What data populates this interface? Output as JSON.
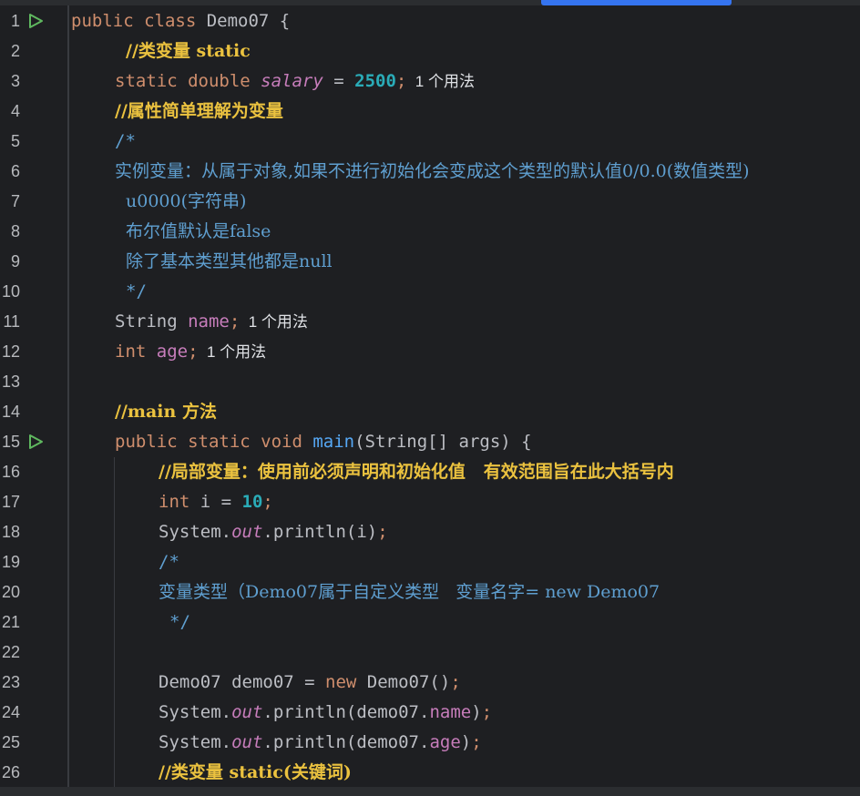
{
  "editor": {
    "lines": [
      {
        "n": "1",
        "run": true,
        "indent": 78,
        "tokens": [
          {
            "t": "public class ",
            "c": "kw"
          },
          {
            "t": "Demo07 {",
            "c": "plain"
          }
        ]
      },
      {
        "n": "2",
        "indent": 138,
        "tokens": [
          {
            "t": "//类变量 static",
            "c": "cmt"
          }
        ]
      },
      {
        "n": "3",
        "indent": 126,
        "tokens": [
          {
            "t": "static double ",
            "c": "kw"
          },
          {
            "t": "salary",
            "c": "static-field"
          },
          {
            "t": " = ",
            "c": "plain"
          },
          {
            "t": "2500",
            "c": "num"
          },
          {
            "t": ";",
            "c": "semi"
          }
        ],
        "hint": "1 个用法"
      },
      {
        "n": "4",
        "indent": 126,
        "tokens": [
          {
            "t": "//属性简单理解为变量",
            "c": "cmt"
          }
        ]
      },
      {
        "n": "5",
        "indent": 126,
        "tokens": [
          {
            "t": "/*",
            "c": "doc"
          }
        ]
      },
      {
        "n": "6",
        "indent": 126,
        "tokens": [
          {
            "t": "实例变量：从属于对象,如果不进行初始化会变成这个类型的默认值0/0.0(数值类型)",
            "c": "doc"
          }
        ]
      },
      {
        "n": "7",
        "indent": 138,
        "tokens": [
          {
            "t": "u0000(字符串)",
            "c": "doc"
          }
        ]
      },
      {
        "n": "8",
        "indent": 138,
        "tokens": [
          {
            "t": "布尔值默认是false",
            "c": "doc"
          }
        ]
      },
      {
        "n": "9",
        "indent": 138,
        "tokens": [
          {
            "t": "除了基本类型其他都是null",
            "c": "doc"
          }
        ]
      },
      {
        "n": "10",
        "indent": 138,
        "tokens": [
          {
            "t": "*/",
            "c": "doc"
          }
        ]
      },
      {
        "n": "11",
        "indent": 126,
        "tokens": [
          {
            "t": "String ",
            "c": "plain"
          },
          {
            "t": "name",
            "c": "field"
          },
          {
            "t": ";",
            "c": "semi"
          }
        ],
        "hint": "1 个用法"
      },
      {
        "n": "12",
        "indent": 126,
        "tokens": [
          {
            "t": "int ",
            "c": "kw"
          },
          {
            "t": "age",
            "c": "field"
          },
          {
            "t": ";",
            "c": "semi"
          }
        ],
        "hint": "1 个用法"
      },
      {
        "n": "13",
        "indent": 126,
        "tokens": []
      },
      {
        "n": "14",
        "indent": 126,
        "tokens": [
          {
            "t": "//main 方法",
            "c": "cmt"
          }
        ]
      },
      {
        "n": "15",
        "run": true,
        "indent": 126,
        "tokens": [
          {
            "t": "public static void ",
            "c": "kw"
          },
          {
            "t": "main",
            "c": "method"
          },
          {
            "t": "(String[] args) {",
            "c": "plain"
          }
        ]
      },
      {
        "n": "16",
        "indent": 174,
        "tokens": [
          {
            "t": "//局部变量：使用前必须声明和初始化值   有效范围旨在此大括号内",
            "c": "cmt"
          }
        ]
      },
      {
        "n": "17",
        "indent": 174,
        "tokens": [
          {
            "t": "int ",
            "c": "kw"
          },
          {
            "t": "i = ",
            "c": "plain"
          },
          {
            "t": "10",
            "c": "num"
          },
          {
            "t": ";",
            "c": "semi"
          }
        ]
      },
      {
        "n": "18",
        "indent": 174,
        "tokens": [
          {
            "t": "System.",
            "c": "plain"
          },
          {
            "t": "out",
            "c": "static-call"
          },
          {
            "t": ".println(i)",
            "c": "plain"
          },
          {
            "t": ";",
            "c": "semi"
          }
        ]
      },
      {
        "n": "19",
        "indent": 174,
        "tokens": [
          {
            "t": "/*",
            "c": "doc"
          }
        ]
      },
      {
        "n": "20",
        "indent": 174,
        "tokens": [
          {
            "t": "变量类型（Demo07属于自定义类型   变量名字= new Demo07",
            "c": "doc"
          }
        ]
      },
      {
        "n": "21",
        "indent": 186,
        "tokens": [
          {
            "t": "*/",
            "c": "doc"
          }
        ]
      },
      {
        "n": "22",
        "indent": 174,
        "tokens": []
      },
      {
        "n": "23",
        "indent": 174,
        "tokens": [
          {
            "t": "Demo07 demo07 = ",
            "c": "plain"
          },
          {
            "t": "new ",
            "c": "kw"
          },
          {
            "t": "Demo07()",
            "c": "plain"
          },
          {
            "t": ";",
            "c": "semi"
          }
        ]
      },
      {
        "n": "24",
        "indent": 174,
        "tokens": [
          {
            "t": "System.",
            "c": "plain"
          },
          {
            "t": "out",
            "c": "static-call"
          },
          {
            "t": ".println(demo07.",
            "c": "plain"
          },
          {
            "t": "name",
            "c": "field"
          },
          {
            "t": ")",
            "c": "plain"
          },
          {
            "t": ";",
            "c": "semi"
          }
        ]
      },
      {
        "n": "25",
        "indent": 174,
        "tokens": [
          {
            "t": "System.",
            "c": "plain"
          },
          {
            "t": "out",
            "c": "static-call"
          },
          {
            "t": ".println(demo07.",
            "c": "plain"
          },
          {
            "t": "age",
            "c": "field"
          },
          {
            "t": ")",
            "c": "plain"
          },
          {
            "t": ";",
            "c": "semi"
          }
        ]
      },
      {
        "n": "26",
        "indent": 174,
        "tokens": [
          {
            "t": "//类变量 static(关键词)",
            "c": "cmt"
          }
        ]
      }
    ]
  },
  "colors": {
    "background": "#1e1f22",
    "keyword": "#cf8e6d",
    "comment": "#ebc23f",
    "doc_comment": "#5f9fd0",
    "field": "#c77dbb",
    "number": "#2aacb8",
    "run_icon": "#5fb85f",
    "scroll_thumb": "#3574f0"
  },
  "icons": {
    "run": "run-gutter-icon"
  }
}
